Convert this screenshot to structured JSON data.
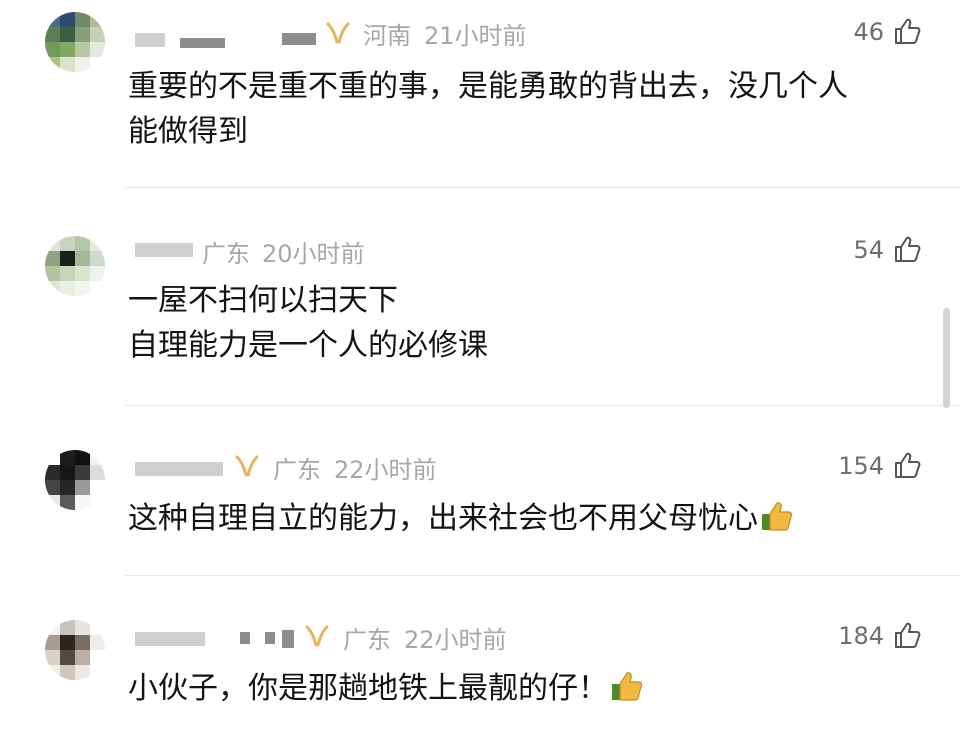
{
  "comments": [
    {
      "location": "河南",
      "time": "21小时前",
      "likes": "46",
      "lines": [
        "重要的不是重不重的事，是能勇敢的背出去，没几个人",
        "能做得到"
      ],
      "has_badge": true
    },
    {
      "location": "广东",
      "time": "20小时前",
      "likes": "54",
      "lines": [
        "一屋不扫何以扫天下",
        "自理能力是一个人的必修课"
      ],
      "has_badge": false
    },
    {
      "location": "广东",
      "time": "22小时前",
      "likes": "154",
      "lines": [
        "这种自理自立的能力，出来社会也不用父母忧心"
      ],
      "has_badge": true,
      "emoji": "thumbs-up-emoji"
    },
    {
      "location": "广东",
      "time": "22小时前",
      "likes": "184",
      "lines": [
        "小伙子，你是那趟地铁上最靓的仔！"
      ],
      "has_badge": true,
      "emoji": "thumbs-up-emoji"
    }
  ],
  "colors": {
    "meta": "#a7a7a7",
    "text": "#141414",
    "badge": "#e6b55a",
    "divider": "#e9e9e9"
  },
  "icons": {
    "like": "thumbs-up-outline-icon",
    "badge": "gold-badge-icon"
  }
}
